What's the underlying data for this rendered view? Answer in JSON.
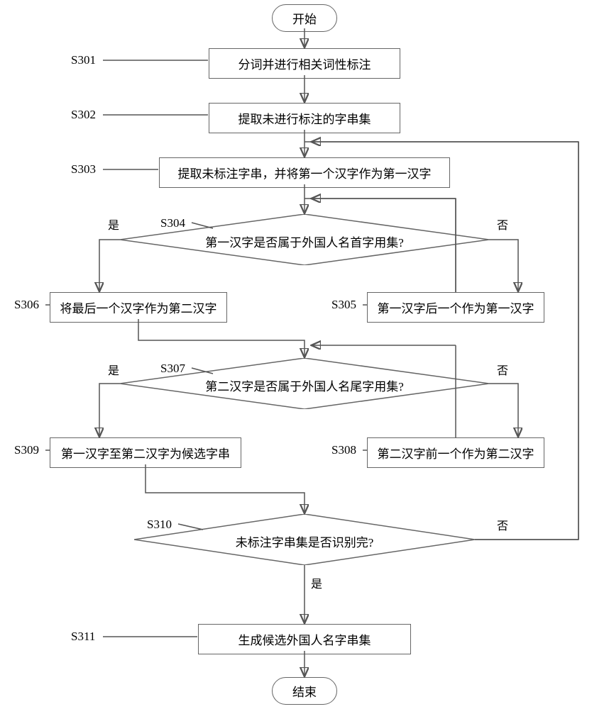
{
  "start": "开始",
  "end": "结束",
  "s301": {
    "label": "S301",
    "text": "分词并进行相关词性标注"
  },
  "s302": {
    "label": "S302",
    "text": "提取未进行标注的字串集"
  },
  "s303": {
    "label": "S303",
    "text": "提取未标注字串，并将第一个汉字作为第一汉字"
  },
  "s304": {
    "label": "S304",
    "text": "第一汉字是否属于外国人名首字用集?"
  },
  "s305": {
    "label": "S305",
    "text": "第一汉字后一个作为第一汉字"
  },
  "s306": {
    "label": "S306",
    "text": "将最后一个汉字作为第二汉字"
  },
  "s307": {
    "label": "S307",
    "text": "第二汉字是否属于外国人名尾字用集?"
  },
  "s308": {
    "label": "S308",
    "text": "第二汉字前一个作为第二汉字"
  },
  "s309": {
    "label": "S309",
    "text": "第一汉字至第二汉字为候选字串"
  },
  "s310": {
    "label": "S310",
    "text": "未标注字串集是否识别完?"
  },
  "s311": {
    "label": "S311",
    "text": "生成候选外国人名字串集"
  },
  "yes": "是",
  "no": "否"
}
